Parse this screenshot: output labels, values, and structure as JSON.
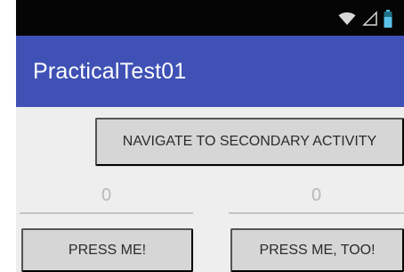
{
  "status_bar": {
    "icons": [
      "wifi-icon",
      "signal-icon",
      "battery-icon"
    ],
    "colors": {
      "background": "#050505",
      "icon": "#d8d8d8",
      "battery": "#5bc2e7"
    }
  },
  "app_bar": {
    "title": "PracticalTest01",
    "background": "#3f51b5"
  },
  "main": {
    "navigate_button": {
      "label": "NAVIGATE TO SECONDARY ACTIVITY"
    },
    "left_counter": {
      "value": "0"
    },
    "right_counter": {
      "value": "0"
    },
    "press_me_button": {
      "label": "PRESS ME!"
    },
    "press_me_too_button": {
      "label": "PRESS ME, TOO!"
    }
  },
  "colors": {
    "screen_background": "#eeeeee",
    "button_background": "#d6d6d6",
    "button_text": "#2b2b2b",
    "counter_text": "#b9b9b9",
    "counter_underline": "#c5c5c5"
  }
}
